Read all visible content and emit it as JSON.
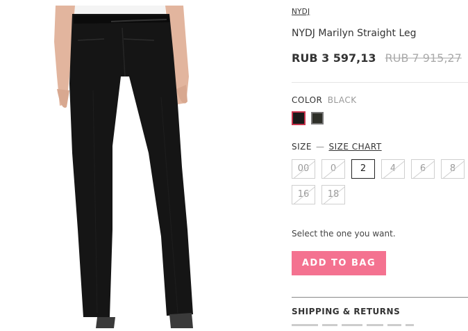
{
  "product": {
    "brand": "NYDJ",
    "title": "NYDJ Marilyn Straight Leg",
    "price_sale": "RUB 3 597,13",
    "price_original": "RUB 7 915,27",
    "image_icon": "trousers-photo"
  },
  "color": {
    "label": "COLOR",
    "selected": "BLACK",
    "swatches": [
      {
        "name": "black",
        "hex": "#1a1a1a"
      },
      {
        "name": "charcoal",
        "hex": "#2e2f28"
      }
    ]
  },
  "size": {
    "label": "SIZE",
    "separator": "—",
    "chart_link": "SIZE CHART",
    "options": [
      {
        "label": "00",
        "available": false
      },
      {
        "label": "0",
        "available": false
      },
      {
        "label": "2",
        "available": true,
        "selected": true
      },
      {
        "label": "4",
        "available": false
      },
      {
        "label": "6",
        "available": false
      },
      {
        "label": "8",
        "available": false
      },
      {
        "label": "16",
        "available": false
      },
      {
        "label": "18",
        "available": false
      }
    ]
  },
  "helper_text": "Select the one you want.",
  "add_to_bag": "ADD TO BAG",
  "shipping_title": "SHIPPING & RETURNS",
  "colors": {
    "accent": "#f47290",
    "selected_outline": "#c8344d"
  }
}
